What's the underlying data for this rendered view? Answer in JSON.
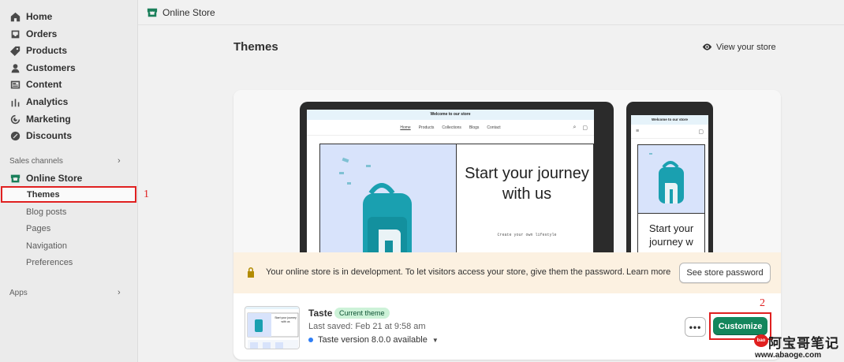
{
  "topbar": {
    "title": "Online Store"
  },
  "sidebar": {
    "items": [
      {
        "label": "Home",
        "icon": "home-icon"
      },
      {
        "label": "Orders",
        "icon": "inbox-icon"
      },
      {
        "label": "Products",
        "icon": "tag-icon"
      },
      {
        "label": "Customers",
        "icon": "person-icon"
      },
      {
        "label": "Content",
        "icon": "content-icon"
      },
      {
        "label": "Analytics",
        "icon": "bar-chart-icon"
      },
      {
        "label": "Marketing",
        "icon": "target-icon"
      },
      {
        "label": "Discounts",
        "icon": "discount-icon"
      }
    ],
    "sales_channels_label": "Sales channels",
    "online_store_label": "Online Store",
    "sub_items": [
      "Themes",
      "Blog posts",
      "Pages",
      "Navigation",
      "Preferences"
    ],
    "apps_label": "Apps"
  },
  "annotations": {
    "one": "1",
    "two": "2"
  },
  "header": {
    "title": "Themes",
    "view_store": "View your store"
  },
  "preview": {
    "announcement": "Welcome to our store",
    "nav": [
      "Home",
      "Products",
      "Collections",
      "Blogs",
      "Contact"
    ],
    "hero_heading": "Start your journey with us",
    "hero_sub": "Create your own lifestyle",
    "phone_hero_heading": "Start your journey w"
  },
  "banner": {
    "text": "Your online store is in development. To let visitors access your store, give them the password.",
    "learn_more": "Learn more",
    "password_button": "See store password"
  },
  "theme": {
    "name": "Taste",
    "badge": "Current theme",
    "last_saved": "Last saved: Feb 21 at 9:58 am",
    "version": "Taste version 8.0.0 available",
    "more_button": "•••",
    "customize_button": "Customize",
    "thumb_text": "Start your journey with us"
  },
  "watermark": {
    "badge": "bao",
    "cn": "阿宝哥笔记",
    "url": "www.abaoge.com"
  },
  "colors": {
    "accent": "#14865c",
    "annotation": "#e02020",
    "banner_bg": "#fcf1e1",
    "badge_bg": "#cdf2d8"
  }
}
